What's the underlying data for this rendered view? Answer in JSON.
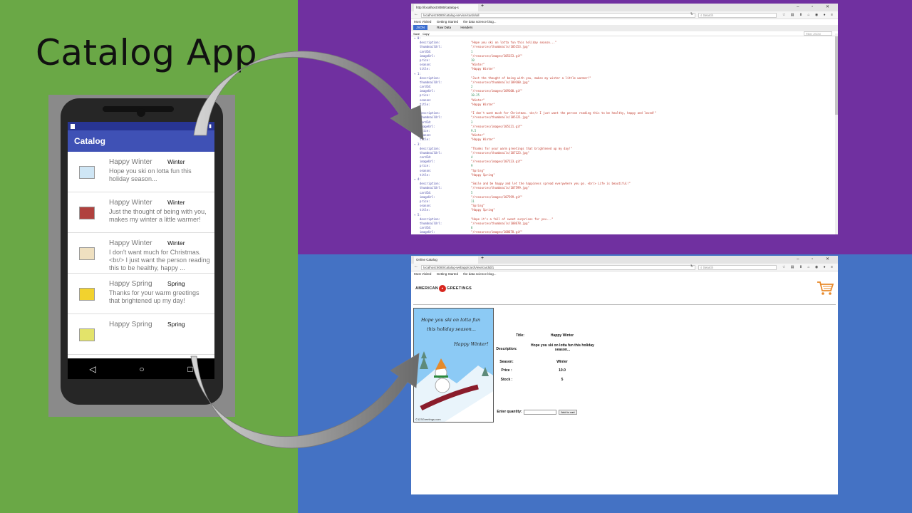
{
  "slide": {
    "title": "Catalog App"
  },
  "phone": {
    "app_bar_title": "Catalog",
    "items": [
      {
        "title": "Happy Winter",
        "season": "Winter",
        "description": "Hope you ski on lotta fun this holiday season..."
      },
      {
        "title": "Happy Winter",
        "season": "Winter",
        "description": "Just the thought of being with you, makes my winter a little warmer!"
      },
      {
        "title": "Happy Winter",
        "season": "Winter",
        "description": "I don't want much for Christmas. <br/> I just want the person reading this to be healthy, happy ..."
      },
      {
        "title": "Happy Spring",
        "season": "Spring",
        "description": "Thanks for your warm greetings that brightened up my day!"
      },
      {
        "title": "Happy Spring",
        "season": "Spring",
        "description": ""
      }
    ]
  },
  "json_browser": {
    "tab_title": "http://localhost:8080/catalog-s",
    "url": "localhost:8080/catalog-service/cards/all",
    "search_placeholder": "Search",
    "bookmarks": [
      "Most Visited",
      "Getting Started",
      "the data science blog..."
    ],
    "viewer_tabs": [
      "JSON",
      "Raw Data",
      "Headers"
    ],
    "actions": [
      "Save",
      "Copy"
    ],
    "filter_placeholder": "Filter JSON",
    "lines": [
      {
        "indent": 0,
        "index": "▾ 0:"
      },
      {
        "indent": 1,
        "key": "description:",
        "value": "\"Hope you ski on lotta fun this holiday season...\"",
        "type": "s"
      },
      {
        "indent": 1,
        "key": "thumbnailUrl:",
        "value": "\"/resources/thumbnails/105153.jpg\"",
        "type": "s"
      },
      {
        "indent": 1,
        "key": "cardId:",
        "value": "1",
        "type": "n"
      },
      {
        "indent": 1,
        "key": "imageUrl:",
        "value": "\"/resources/images/105153.gif\"",
        "type": "s"
      },
      {
        "indent": 1,
        "key": "price:",
        "value": "10",
        "type": "n"
      },
      {
        "indent": 1,
        "key": "season:",
        "value": "\"Winter\"",
        "type": "s"
      },
      {
        "indent": 1,
        "key": "title:",
        "value": "\"Happy Winter\"",
        "type": "s"
      },
      {
        "indent": 0,
        "index": "▾ 1:"
      },
      {
        "indent": 1,
        "key": "description:",
        "value": "\"Just the thought of being with you, makes my winter a little warmer!\"",
        "type": "s"
      },
      {
        "indent": 1,
        "key": "thumbnailUrl:",
        "value": "\"/resources/thumbnails/109100.jpg\"",
        "type": "s"
      },
      {
        "indent": 1,
        "key": "cardId:",
        "value": "2",
        "type": "n"
      },
      {
        "indent": 1,
        "key": "imageUrl:",
        "value": "\"/resources/images/109100.gif\"",
        "type": "s"
      },
      {
        "indent": 1,
        "key": "price:",
        "value": "10.25",
        "type": "n"
      },
      {
        "indent": 1,
        "key": "season:",
        "value": "\"Winter\"",
        "type": "s"
      },
      {
        "indent": 1,
        "key": "title:",
        "value": "\"Happy Winter\"",
        "type": "s"
      },
      {
        "indent": 0,
        "index": "▾ 2:"
      },
      {
        "indent": 1,
        "key": "description:",
        "value": "\"I don't want much for Christmas. <br/> I just want the person reading this to be healthy, happy and loved!\"",
        "type": "s"
      },
      {
        "indent": 1,
        "key": "thumbnailUrl:",
        "value": "\"/resources/thumbnails/105121.jpg\"",
        "type": "s"
      },
      {
        "indent": 1,
        "key": "cardId:",
        "value": "3",
        "type": "n"
      },
      {
        "indent": 1,
        "key": "imageUrl:",
        "value": "\"/resources/images/105121.gif\"",
        "type": "s"
      },
      {
        "indent": 1,
        "key": "price:",
        "value": "9.5",
        "type": "n"
      },
      {
        "indent": 1,
        "key": "season:",
        "value": "\"Winter\"",
        "type": "s"
      },
      {
        "indent": 1,
        "key": "title:",
        "value": "\"Happy Winter\"",
        "type": "s"
      },
      {
        "indent": 0,
        "index": "▾ 3:"
      },
      {
        "indent": 1,
        "key": "description:",
        "value": "\"Thanks for your warm greetings that brightened up my day!\"",
        "type": "s"
      },
      {
        "indent": 1,
        "key": "thumbnailUrl:",
        "value": "\"/resources/thumbnails/107123.jpg\"",
        "type": "s"
      },
      {
        "indent": 1,
        "key": "cardId:",
        "value": "4",
        "type": "n"
      },
      {
        "indent": 1,
        "key": "imageUrl:",
        "value": "\"/resources/images/107123.gif\"",
        "type": "s"
      },
      {
        "indent": 1,
        "key": "price:",
        "value": "9",
        "type": "n"
      },
      {
        "indent": 1,
        "key": "season:",
        "value": "\"Spring\"",
        "type": "s"
      },
      {
        "indent": 1,
        "key": "title:",
        "value": "\"Happy Spring\"",
        "type": "s"
      },
      {
        "indent": 0,
        "index": "▾ 4:"
      },
      {
        "indent": 1,
        "key": "description:",
        "value": "\"Smile and be happy and let the happiness spread everywhere you go. <br/> Life is beautiful!\"",
        "type": "s"
      },
      {
        "indent": 1,
        "key": "thumbnailUrl:",
        "value": "\"/resources/thumbnails/107599.jpg\"",
        "type": "s"
      },
      {
        "indent": 1,
        "key": "cardId:",
        "value": "5",
        "type": "n"
      },
      {
        "indent": 1,
        "key": "imageUrl:",
        "value": "\"/resources/images/107599.gif\"",
        "type": "s"
      },
      {
        "indent": 1,
        "key": "price:",
        "value": "11",
        "type": "n"
      },
      {
        "indent": 1,
        "key": "season:",
        "value": "\"Spring\"",
        "type": "s"
      },
      {
        "indent": 1,
        "key": "title:",
        "value": "\"Happy Spring\"",
        "type": "s"
      },
      {
        "indent": 0,
        "index": "▾ 5:"
      },
      {
        "indent": 1,
        "key": "description:",
        "value": "\"Hope it's a fall of sweet surprises for you...\"",
        "type": "s"
      },
      {
        "indent": 1,
        "key": "thumbnailUrl:",
        "value": "\"/resources/thumbnails/108678.jpg\"",
        "type": "s"
      },
      {
        "indent": 1,
        "key": "cardId:",
        "value": "6",
        "type": "n"
      },
      {
        "indent": 1,
        "key": "imageUrl:",
        "value": "\"/resources/images/108678.gif\"",
        "type": "s"
      }
    ]
  },
  "web_browser": {
    "tab_title": "Online Catalog",
    "url": "localhost:8080/catalog-webapp/cardView/cardId/1",
    "search_placeholder": "Search",
    "bookmarks": [
      "Most Visited",
      "Getting Started",
      "the data science blog..."
    ],
    "brand_left": "AMERICAN",
    "brand_right": "GREETINGS",
    "card_text_line1": "Hope you ski on lotta fun",
    "card_text_line2": "this holiday season...",
    "card_text_greeting": "Happy Winter!",
    "card_credit": "©123Greetings.com",
    "labels": {
      "title": "Title:",
      "description": "Description:",
      "season": "Season:",
      "price": "Price :",
      "stock": "Stock :",
      "quantity": "Enter quantity:"
    },
    "values": {
      "title": "Happy Winter",
      "description": "Hope you ski on lotta fun this holiday season...",
      "season": "Winter",
      "price": "10.0",
      "stock": "5"
    },
    "quantity_value": "",
    "add_to_cart_label": "Add to cart"
  },
  "colors": {
    "green_panel": "#6aa846",
    "purple_panel": "#7030a0",
    "blue_panel": "#4472c4",
    "android_primary": "#3f51b5",
    "android_primary_dark": "#283593"
  },
  "icons": [
    "back-icon",
    "home-icon",
    "recents-icon",
    "cart-icon",
    "reload-icon",
    "search-icon"
  ]
}
